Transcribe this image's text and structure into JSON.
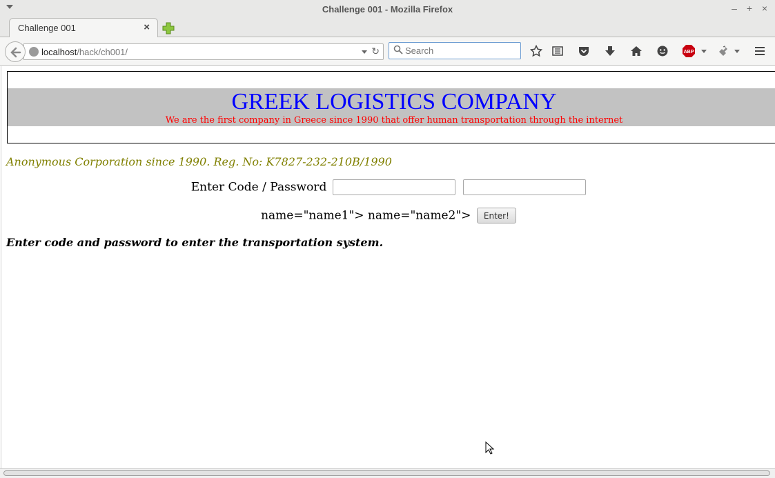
{
  "window": {
    "title": "Challenge 001 - Mozilla Firefox",
    "minimize": "–",
    "maximize": "+",
    "close": "×"
  },
  "tabs": [
    {
      "title": "Challenge 001",
      "close": "×"
    }
  ],
  "toolbar": {
    "url_host": "localhost",
    "url_path": "/hack/ch001/",
    "reload": "↻",
    "search_placeholder": "Search",
    "icons": [
      "star-icon",
      "reading-list-icon",
      "pocket-icon",
      "download-icon",
      "home-icon",
      "chat-icon",
      "adblock-icon",
      "extension-icon",
      "hamburger-menu-icon"
    ],
    "adblock_label": "ABP"
  },
  "page": {
    "company_name": "GREEK LOGISTICS COMPANY",
    "tagline": "We are the first company in Greece since 1990 that offer human transportation through the internet",
    "corp_info": "Anonymous Corporation since 1990. Reg. No: K7827-232-210B/1990",
    "login_label": "Enter Code / Password",
    "code_value": "",
    "password_value": "",
    "leaked_markup": "name=\"name1\"> name=\"name2\">",
    "submit_label": "Enter!",
    "instruction": "Enter code and password to enter the transportation system."
  },
  "colors": {
    "company_name": "#0000ff",
    "tagline": "#ff0000",
    "corp_info": "#808000",
    "banner_bg": "#c2c2c2"
  }
}
